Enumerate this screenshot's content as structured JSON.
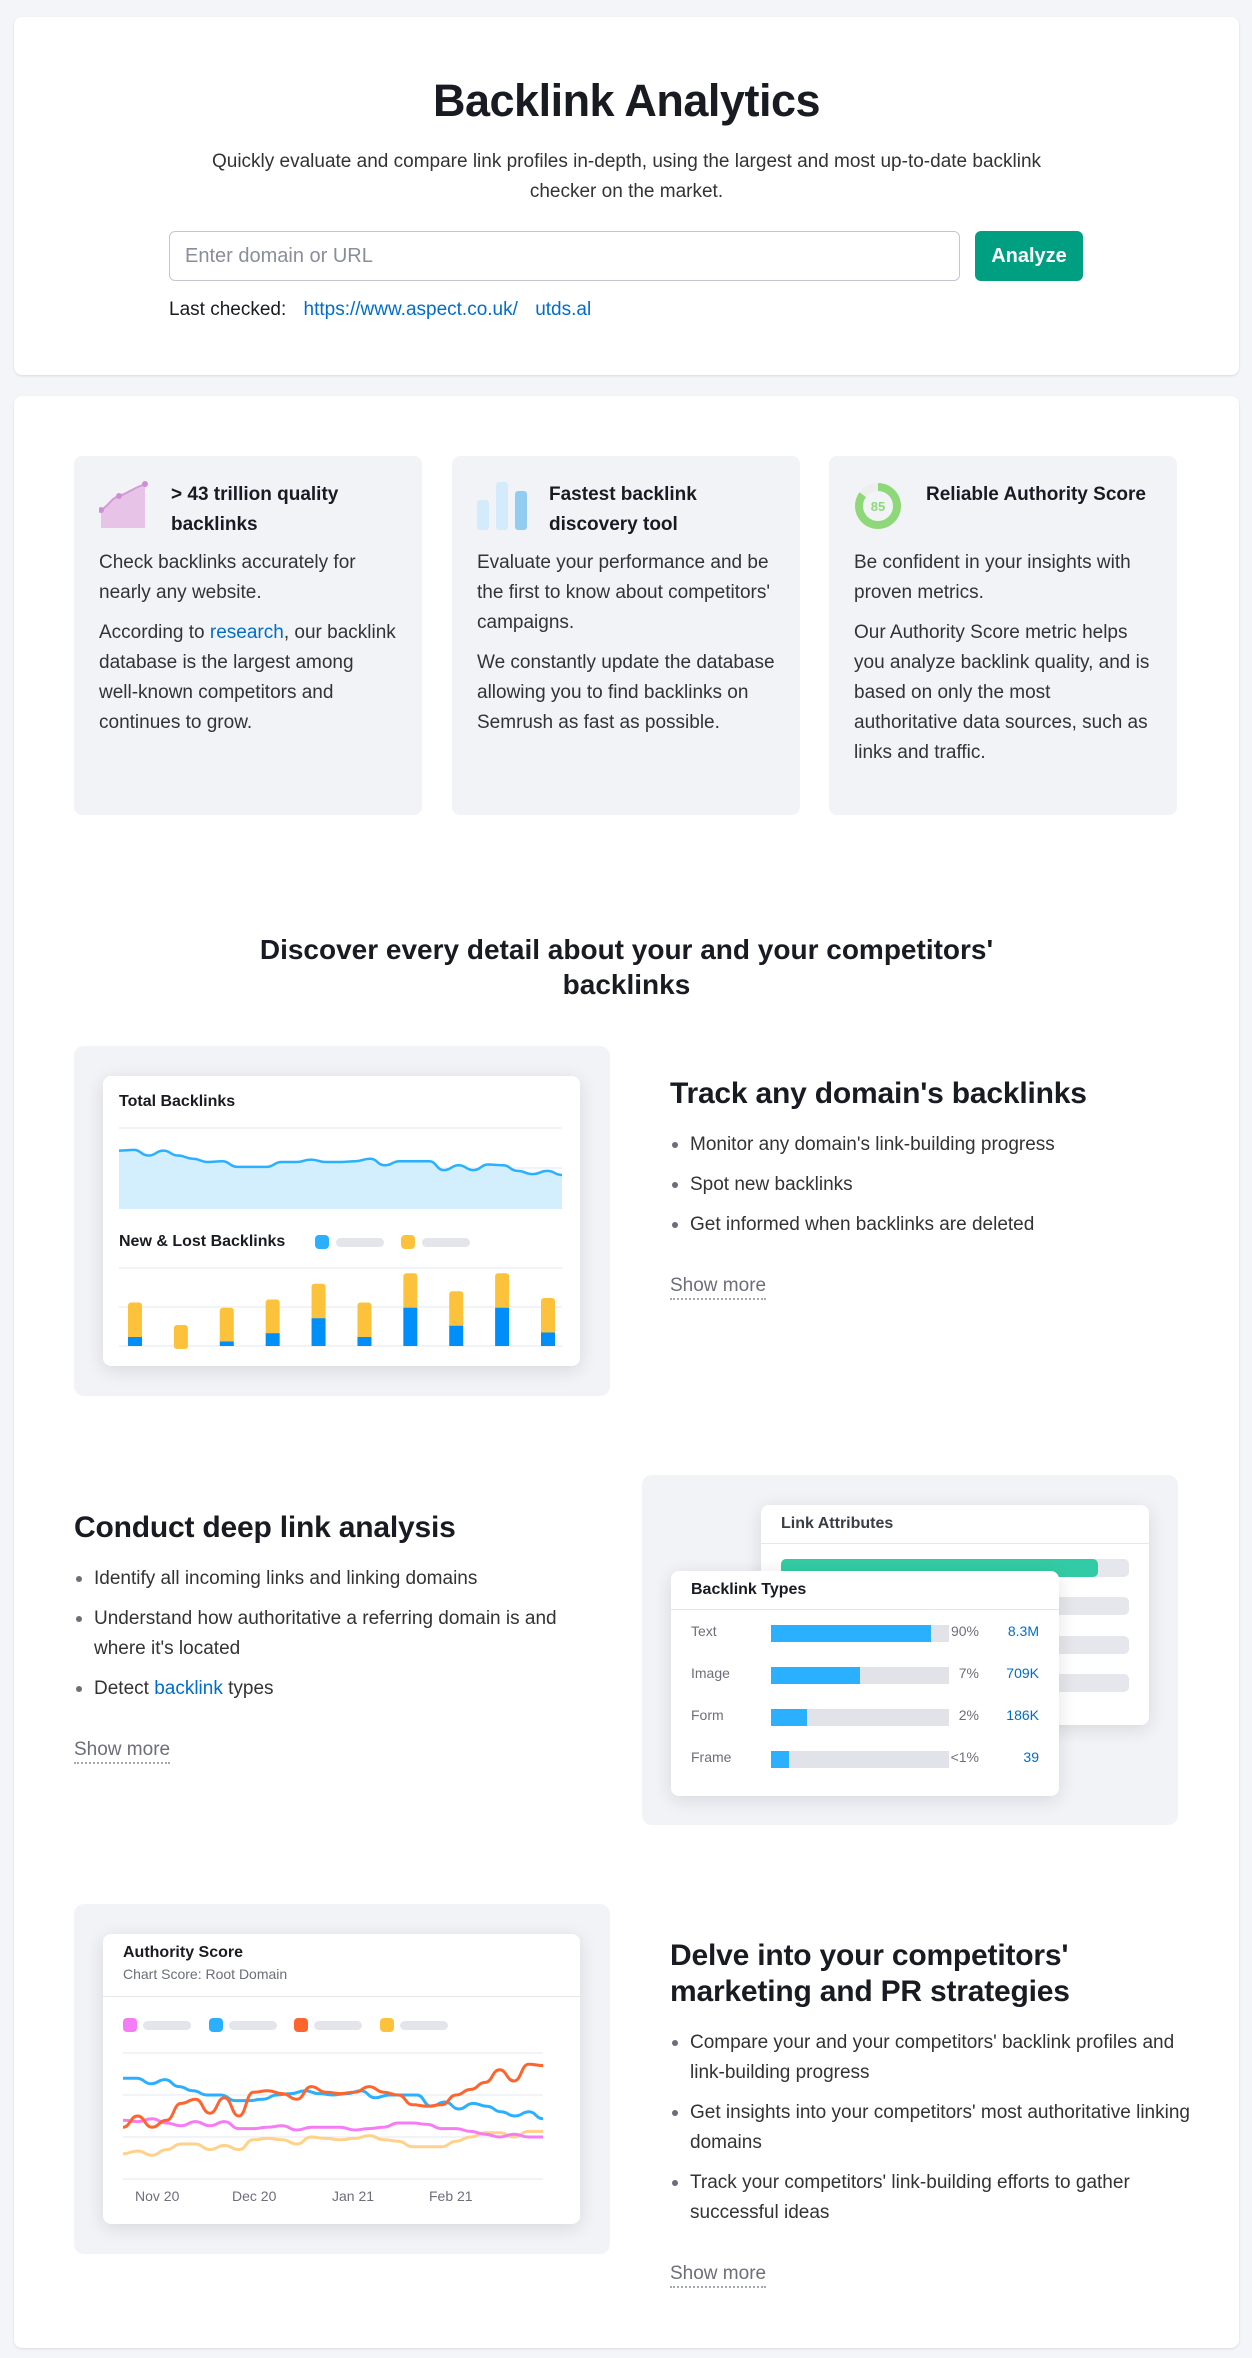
{
  "hero": {
    "title": "Backlink Analytics",
    "subtitle": "Quickly evaluate and compare link profiles in-depth, using the largest and most up-to-date backlink checker on the market.",
    "search_placeholder": "Enter domain or URL",
    "search_value": "",
    "analyze_label": "Analyze",
    "last_checked_label": "Last checked:",
    "last_checked_links": [
      "https://www.aspect.co.uk/",
      "utds.al"
    ]
  },
  "features": [
    {
      "icon": "growth-chart-icon",
      "title": "> 43 trillion quality backlinks",
      "p1": "Check backlinks accurately for nearly any website.",
      "p2_before": "According to ",
      "p2_link": "research",
      "p2_after": ", our backlink database is the largest among well-known competitors and continues to grow."
    },
    {
      "icon": "bar-chart-icon",
      "title": "Fastest backlink discovery tool",
      "p1": "Evaluate your performance and be the first to know about competitors' campaigns.",
      "p2": "We constantly update the database allowing you to find backlinks on Semrush as fast as possible."
    },
    {
      "icon": "authority-score-gauge-icon",
      "gauge_value": "85",
      "title": "Reliable Authority Score",
      "p1": "Be confident in your insights with proven metrics.",
      "p2": "Our Authority Score metric helps you analyze backlink quality, and is based on only the most authoritative data sources, such as links and traffic."
    }
  ],
  "section_title": "Discover every detail about your and your competitors' backlinks",
  "blocks": [
    {
      "title": "Track any domain's backlinks",
      "bullets": [
        "Monitor any domain's link-building progress",
        "Spot new backlinks",
        "Get informed when backlinks are deleted"
      ],
      "show_more": "Show more"
    },
    {
      "title": "Conduct deep link analysis",
      "bullets": [
        "Identify all incoming links and linking domains",
        "Understand how authoritative a referring domain is and where it's located"
      ],
      "bullet3_before": "Detect ",
      "bullet3_link": "backlink",
      "bullet3_after": " types",
      "show_more": "Show more"
    },
    {
      "title": "Delve into your competitors' marketing and PR strategies",
      "bullets": [
        "Compare your and your competitors' backlink profiles and link-building progress",
        "Get insights into your competitors' most authoritative linking domains",
        "Track your competitors' link-building efforts to gather successful ideas"
      ],
      "show_more": "Show more"
    }
  ],
  "illustrations": {
    "total_backlinks": {
      "title": "Total Backlinks",
      "values": [
        72,
        73,
        66,
        72,
        66,
        62,
        58,
        59,
        52,
        52,
        52,
        58,
        58,
        61,
        58,
        58,
        59,
        62,
        54,
        59,
        59,
        59,
        48,
        54,
        48,
        55,
        54,
        47,
        43,
        47,
        42
      ]
    },
    "new_lost": {
      "title": "New & Lost Backlinks",
      "colors": {
        "new": "#008ff8",
        "lost": "#fdc23c"
      },
      "new": [
        12,
        0,
        6,
        17,
        37,
        12,
        51,
        27,
        51,
        18
      ],
      "lost": [
        46,
        28,
        45,
        45,
        46,
        46,
        46,
        46,
        46,
        46
      ]
    },
    "link_attributes": {
      "title": "Link Attributes",
      "top_fill": 0.91
    },
    "backlink_types": {
      "title": "Backlink Types",
      "rows": [
        {
          "label": "Text",
          "fill": 0.9,
          "pct": "90%",
          "value": "8.3M"
        },
        {
          "label": "Image",
          "fill": 0.5,
          "pct": "7%",
          "value": "709K"
        },
        {
          "label": "Form",
          "fill": 0.2,
          "pct": "2%",
          "value": "186K"
        },
        {
          "label": "Frame",
          "fill": 0.1,
          "pct": "<1%",
          "value": "39"
        }
      ]
    },
    "authority_score": {
      "title": "Authority Score",
      "subtitle": "Chart Score: Root Domain",
      "x_labels": [
        "Nov 20",
        "Dec 20",
        "Jan 21",
        "Feb 21"
      ],
      "series": [
        {
          "color": "#f67cf6",
          "values": [
            42,
            41,
            43,
            40,
            38,
            41,
            38,
            41,
            36,
            36,
            37,
            38,
            35,
            37,
            37,
            37,
            35,
            36,
            37,
            40,
            40,
            39,
            36,
            36,
            34,
            32,
            30,
            32,
            30,
            30
          ]
        },
        {
          "color": "#2bb0ff",
          "values": [
            72,
            72,
            68,
            71,
            66,
            63,
            60,
            60,
            56,
            56,
            57,
            60,
            61,
            63,
            61,
            60,
            61,
            63,
            58,
            60,
            60,
            60,
            52,
            55,
            50,
            54,
            52,
            48,
            45,
            48,
            43
          ]
        },
        {
          "color": "#ff642d",
          "values": [
            37,
            45,
            37,
            42,
            54,
            57,
            47,
            58,
            45,
            62,
            63,
            61,
            57,
            66,
            62,
            61,
            62,
            66,
            62,
            60,
            53,
            52,
            53,
            60,
            64,
            69,
            78,
            70,
            82,
            81
          ]
        },
        {
          "color": "#ffd18b",
          "values": [
            18,
            20,
            17,
            21,
            25,
            25,
            21,
            24,
            21,
            28,
            29,
            28,
            25,
            30,
            29,
            28,
            29,
            31,
            28,
            27,
            23,
            23,
            23,
            27,
            30,
            33,
            33,
            30,
            34,
            34
          ]
        }
      ]
    }
  }
}
